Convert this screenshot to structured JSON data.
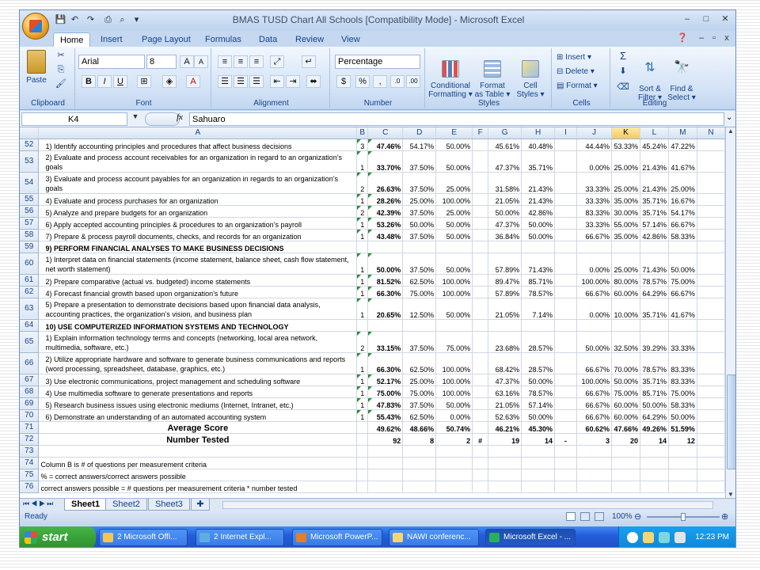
{
  "window": {
    "title": "BMAS TUSD Chart All Schools  [Compatibility Mode]  -  Microsoft Excel",
    "controls": [
      "–",
      "□",
      "✕"
    ]
  },
  "ribbon": {
    "tabs": [
      "Home",
      "Insert",
      "Page Layout",
      "Formulas",
      "Data",
      "Review",
      "View"
    ],
    "active_tab": "Home",
    "clipboard": {
      "label": "Clipboard",
      "paste": "Paste"
    },
    "font": {
      "label": "Font",
      "name": "Arial",
      "size": "8"
    },
    "alignment": {
      "label": "Alignment"
    },
    "number": {
      "label": "Number",
      "format": "Percentage"
    },
    "styles": {
      "label": "Styles",
      "conditional": "Conditional\nFormatting ▾",
      "format_table": "Format\nas Table ▾",
      "cell_styles": "Cell\nStyles ▾"
    },
    "cells": {
      "label": "Cells",
      "insert": "Insert ▾",
      "delete": "Delete ▾",
      "format": "Format ▾"
    },
    "editing": {
      "label": "Editing",
      "sort": "Sort &\nFilter ▾",
      "find": "Find &\nSelect ▾"
    }
  },
  "formula_bar": {
    "name_box": "K4",
    "fx": "fx",
    "value": "Sahuaro"
  },
  "columns": [
    "A",
    "B",
    "C",
    "D",
    "E",
    "F",
    "G",
    "H",
    "I",
    "J",
    "K",
    "L",
    "M",
    "N"
  ],
  "selected_column": "K",
  "rows": [
    {
      "n": "52",
      "a": "1) Identify accounting principles and procedures that affect business decisions",
      "b": "3",
      "c": "47.46%",
      "d": "54.17%",
      "e": "50.00%",
      "f": "",
      "g": "45.61%",
      "h": "40.48%",
      "i": "",
      "j": "44.44%",
      "k": "53.33%",
      "l": "45.24%",
      "m": "47.22%"
    },
    {
      "n": "53",
      "tall": true,
      "a": "2) Evaluate and process account receivables for an organization in regard to an organization’s goals",
      "b": "1",
      "c": "33.70%",
      "d": "37.50%",
      "e": "50.00%",
      "f": "",
      "g": "47.37%",
      "h": "35.71%",
      "i": "",
      "j": "0.00%",
      "k": "25.00%",
      "l": "21.43%",
      "m": "41.67%"
    },
    {
      "n": "54",
      "tall": true,
      "a": "3) Evaluate and process account payables for an organization in regards to an organization’s goals",
      "b": "2",
      "c": "26.63%",
      "d": "37.50%",
      "e": "25.00%",
      "f": "",
      "g": "31.58%",
      "h": "21.43%",
      "i": "",
      "j": "33.33%",
      "k": "25.00%",
      "l": "21.43%",
      "m": "25.00%"
    },
    {
      "n": "55",
      "a": "4) Evaluate and process purchases for an organization",
      "b": "1",
      "c": "28.26%",
      "d": "25.00%",
      "e": "100.00%",
      "f": "",
      "g": "21.05%",
      "h": "21.43%",
      "i": "",
      "j": "33.33%",
      "k": "35.00%",
      "l": "35.71%",
      "m": "16.67%"
    },
    {
      "n": "56",
      "a": "5) Analyze and prepare budgets for an organization",
      "b": "2",
      "c": "42.39%",
      "d": "37.50%",
      "e": "25.00%",
      "f": "",
      "g": "50.00%",
      "h": "42.86%",
      "i": "",
      "j": "83.33%",
      "k": "30.00%",
      "l": "35.71%",
      "m": "54.17%"
    },
    {
      "n": "57",
      "a": "6) Apply accepted accounting principles & procedures to an organization’s payroll",
      "b": "1",
      "c": "53.26%",
      "d": "50.00%",
      "e": "50.00%",
      "f": "",
      "g": "47.37%",
      "h": "50.00%",
      "i": "",
      "j": "33.33%",
      "k": "55.00%",
      "l": "57.14%",
      "m": "66.67%"
    },
    {
      "n": "58",
      "a": "7) Prepare & process payroll documents, checks, and records for an organization",
      "b": "1",
      "c": "43.48%",
      "d": "37.50%",
      "e": "50.00%",
      "f": "",
      "g": "36.84%",
      "h": "50.00%",
      "i": "",
      "j": "66.67%",
      "k": "35.00%",
      "l": "42.86%",
      "m": "58.33%"
    },
    {
      "n": "59",
      "heading": true,
      "a": "9) PERFORM FINANCIAL ANALYSES TO MAKE BUSINESS DECISIONS",
      "b": "",
      "c": "",
      "d": "",
      "e": "",
      "f": "",
      "g": "",
      "h": "",
      "i": "",
      "j": "",
      "k": "",
      "l": "",
      "m": ""
    },
    {
      "n": "60",
      "tall": true,
      "a": "1) Interpret data on financial statements (income statement, balance sheet, cash flow statement, net worth statement)",
      "b": "1",
      "c": "50.00%",
      "d": "37.50%",
      "e": "50.00%",
      "f": "",
      "g": "57.89%",
      "h": "71.43%",
      "i": "",
      "j": "0.00%",
      "k": "25.00%",
      "l": "71.43%",
      "m": "50.00%"
    },
    {
      "n": "61",
      "a": "2) Prepare comparative (actual vs. budgeted) income statements",
      "b": "1",
      "c": "81.52%",
      "d": "62.50%",
      "e": "100.00%",
      "f": "",
      "g": "89.47%",
      "h": "85.71%",
      "i": "",
      "j": "100.00%",
      "k": "80.00%",
      "l": "78.57%",
      "m": "75.00%"
    },
    {
      "n": "62",
      "a": "4) Forecast financial growth based upon organization’s future",
      "b": "1",
      "c": "66.30%",
      "d": "75.00%",
      "e": "100.00%",
      "f": "",
      "g": "57.89%",
      "h": "78.57%",
      "i": "",
      "j": "66.67%",
      "k": "60.00%",
      "l": "64.29%",
      "m": "66.67%"
    },
    {
      "n": "63",
      "tall": true,
      "a": "5) Prepare a presentation to demonstrate decisions based upon financial data analysis, accounting practices, the organization’s vision, and  business plan",
      "b": "1",
      "c": "20.65%",
      "d": "12.50%",
      "e": "50.00%",
      "f": "",
      "g": "21.05%",
      "h": "7.14%",
      "i": "",
      "j": "0.00%",
      "k": "10.00%",
      "l": "35.71%",
      "m": "41.67%"
    },
    {
      "n": "64",
      "heading": true,
      "a": "10) USE COMPUTERIZED INFORMATION SYSTEMS AND TECHNOLOGY",
      "b": "",
      "c": "",
      "d": "",
      "e": "",
      "f": "",
      "g": "",
      "h": "",
      "i": "",
      "j": "",
      "k": "",
      "l": "",
      "m": ""
    },
    {
      "n": "65",
      "tall": true,
      "a": "1) Explain information technology terms and concepts (networking, local area network, multimedia, software, etc.)",
      "b": "2",
      "c": "33.15%",
      "d": "37.50%",
      "e": "75.00%",
      "f": "",
      "g": "23.68%",
      "h": "28.57%",
      "i": "",
      "j": "50.00%",
      "k": "32.50%",
      "l": "39.29%",
      "m": "33.33%"
    },
    {
      "n": "66",
      "tall": true,
      "a": "2) Utilize appropriate hardware and software to generate business communications and reports (word processing, spreadsheet, database, graphics, etc.)",
      "b": "1",
      "c": "66.30%",
      "d": "62.50%",
      "e": "100.00%",
      "f": "",
      "g": "68.42%",
      "h": "28.57%",
      "i": "",
      "j": "66.67%",
      "k": "70.00%",
      "l": "78.57%",
      "m": "83.33%"
    },
    {
      "n": "67",
      "a": "3) Use electronic communications, project management and scheduling software",
      "b": "1",
      "c": "52.17%",
      "d": "25.00%",
      "e": "100.00%",
      "f": "",
      "g": "47.37%",
      "h": "50.00%",
      "i": "",
      "j": "100.00%",
      "k": "50.00%",
      "l": "35.71%",
      "m": "83.33%"
    },
    {
      "n": "68",
      "a": "4) Use multimedia software to generate presentations and reports",
      "b": "1",
      "c": "75.00%",
      "d": "75.00%",
      "e": "100.00%",
      "f": "",
      "g": "63.16%",
      "h": "78.57%",
      "i": "",
      "j": "66.67%",
      "k": "75.00%",
      "l": "85.71%",
      "m": "75.00%"
    },
    {
      "n": "69",
      "a": "5) Research business issues using electronic mediums (Internet, Intranet, etc.)",
      "b": "1",
      "c": "47.83%",
      "d": "37.50%",
      "e": "50.00%",
      "f": "",
      "g": "21.05%",
      "h": "57.14%",
      "i": "",
      "j": "66.67%",
      "k": "60.00%",
      "l": "50.00%",
      "m": "58.33%"
    },
    {
      "n": "70",
      "a": "6) Demonstrate an understanding of an automated accounting system",
      "b": "1",
      "c": "55.43%",
      "d": "62.50%",
      "e": "0.00%",
      "f": "",
      "g": "52.63%",
      "h": "50.00%",
      "i": "",
      "j": "66.67%",
      "k": "60.00%",
      "l": "64.29%",
      "m": "50.00%"
    },
    {
      "n": "71",
      "summary": true,
      "a": "Average Score",
      "b": "",
      "c": "49.62%",
      "d": "48.66%",
      "e": "50.74%",
      "f": "",
      "g": "46.21%",
      "h": "45.30%",
      "i": "",
      "j": "60.62%",
      "k": "47.66%",
      "l": "49.26%",
      "m": "51.59%"
    },
    {
      "n": "72",
      "summary": true,
      "a": "Number Tested",
      "b": "",
      "c": "92",
      "d": "8",
      "e": "2",
      "f": "#",
      "g": "19",
      "h": "14",
      "i": "-",
      "j": "3",
      "k": "20",
      "l": "14",
      "m": "12"
    },
    {
      "n": "73",
      "a": "",
      "b": "",
      "c": "",
      "d": "",
      "e": "",
      "f": "",
      "g": "",
      "h": "",
      "i": "",
      "j": "",
      "k": "",
      "l": "",
      "m": ""
    },
    {
      "n": "74",
      "note": true,
      "a": "Column B is # of questions per measurement criteria",
      "b": "",
      "c": "",
      "d": "",
      "e": "",
      "f": "",
      "g": "",
      "h": "",
      "i": "",
      "j": "",
      "k": "",
      "l": "",
      "m": ""
    },
    {
      "n": "75",
      "note": true,
      "a": "% = correct answers/correct answers possible",
      "b": "",
      "c": "",
      "d": "",
      "e": "",
      "f": "",
      "g": "",
      "h": "",
      "i": "",
      "j": "",
      "k": "",
      "l": "",
      "m": ""
    },
    {
      "n": "76",
      "note": true,
      "a": "correct answers possible = # questions per measurement criteria * number tested",
      "b": "",
      "c": "",
      "d": "",
      "e": "",
      "f": "",
      "g": "",
      "h": "",
      "i": "",
      "j": "",
      "k": "",
      "l": "",
      "m": ""
    }
  ],
  "sheets": [
    "Sheet1",
    "Sheet2",
    "Sheet3"
  ],
  "active_sheet": "Sheet1",
  "status": {
    "ready": "Ready",
    "zoom": "100%"
  },
  "taskbar": {
    "start": "start",
    "tasks": [
      "2 Microsoft Offi...",
      "2 Internet Expl...",
      "Microsoft PowerP...",
      "NAWI conferenc...",
      "Microsoft Excel - ..."
    ],
    "active_task": 4,
    "clock": "12:23 PM"
  }
}
